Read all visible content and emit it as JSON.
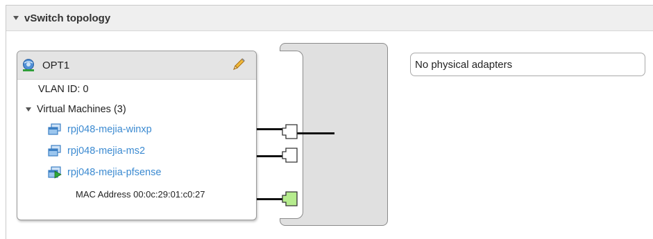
{
  "panel": {
    "title": "vSwitch topology"
  },
  "port_group": {
    "name": "OPT1",
    "vlan_label": "VLAN ID: 0",
    "vm_section_label": "Virtual Machines (3)",
    "vms": [
      {
        "name": "rpj048-mejia-winxp",
        "state": "off"
      },
      {
        "name": "rpj048-mejia-ms2",
        "state": "off"
      },
      {
        "name": "rpj048-mejia-pfsense",
        "state": "running"
      }
    ],
    "mac_label": "MAC Address 00:0c:29:01:c0:27"
  },
  "uplinks": {
    "empty_text": "No physical adapters"
  },
  "colors": {
    "link": "#3b8ad1",
    "active_port": "#b6ec8e",
    "inactive_port": "#ffffff",
    "switch_fill": "#e0e0e0"
  },
  "icons": {
    "portgroup": "network-portgroup-icon",
    "edit": "pencil-edit-icon",
    "vm_off": "vm-icon",
    "vm_on": "vm-running-icon"
  }
}
